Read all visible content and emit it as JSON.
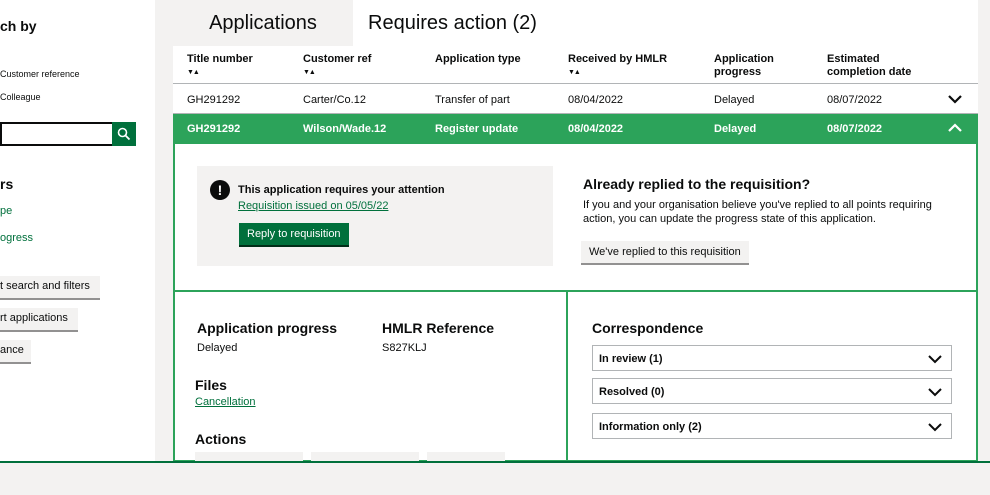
{
  "sidebar": {
    "search_heading": "ch by",
    "radio_customer": "Customer reference",
    "radio_colleague": "Colleague",
    "search_value": "",
    "filters_title": "rs",
    "link_type": "pe",
    "link_progress": "ogress",
    "btn_reset": "t search and filters",
    "btn_export": "rt applications",
    "btn_guidance": "ance"
  },
  "tabs": {
    "applications": "Applications",
    "requires_action": "Requires action (2)"
  },
  "table": {
    "headers": {
      "title_number": "Title number",
      "customer_ref": "Customer ref",
      "application_type": "Application type",
      "received": "Received by HMLR",
      "progress_1": "Application",
      "progress_2": "progress",
      "completion_1": "Estimated",
      "completion_2": "completion date"
    },
    "sort_symbol": "▼▲",
    "rows": [
      {
        "title": "GH291292",
        "ref": "Carter/Co.12",
        "type": "Transfer of part",
        "received": "08/04/2022",
        "progress": "Delayed",
        "completion": "08/07/2022"
      },
      {
        "title": "GH291292",
        "ref": "Wilson/Wade.12",
        "type": "Register update",
        "received": "08/04/2022",
        "progress": "Delayed",
        "completion": "08/07/2022"
      }
    ]
  },
  "panel": {
    "warn_symbol": "!",
    "attention_title": "This application requires your attention",
    "attention_link": "Requisition issued on 05/05/22",
    "reply_button": "Reply to requisition",
    "already_title": "Already replied to the requisition?",
    "already_text": "If you and your organisation believe you've replied to all points requiring action, you can update the progress state of this application.",
    "replied_button": "We've replied to this requisition",
    "progress_label": "Application progress",
    "progress_value": "Delayed",
    "hmlr_label": "HMLR Reference",
    "hmlr_value": "S827KLJ",
    "files_label": "Files",
    "files_link": "Cancellation",
    "actions_label": "Actions",
    "correspondence_label": "Correspondence",
    "correspondence": [
      {
        "label": "In review (1)"
      },
      {
        "label": "Resolved (0)"
      },
      {
        "label": "Information only (2)"
      }
    ]
  },
  "colors": {
    "accent_green": "#00703c",
    "row_highlight": "#2ca35a",
    "page_gray": "#f3f2f1"
  }
}
